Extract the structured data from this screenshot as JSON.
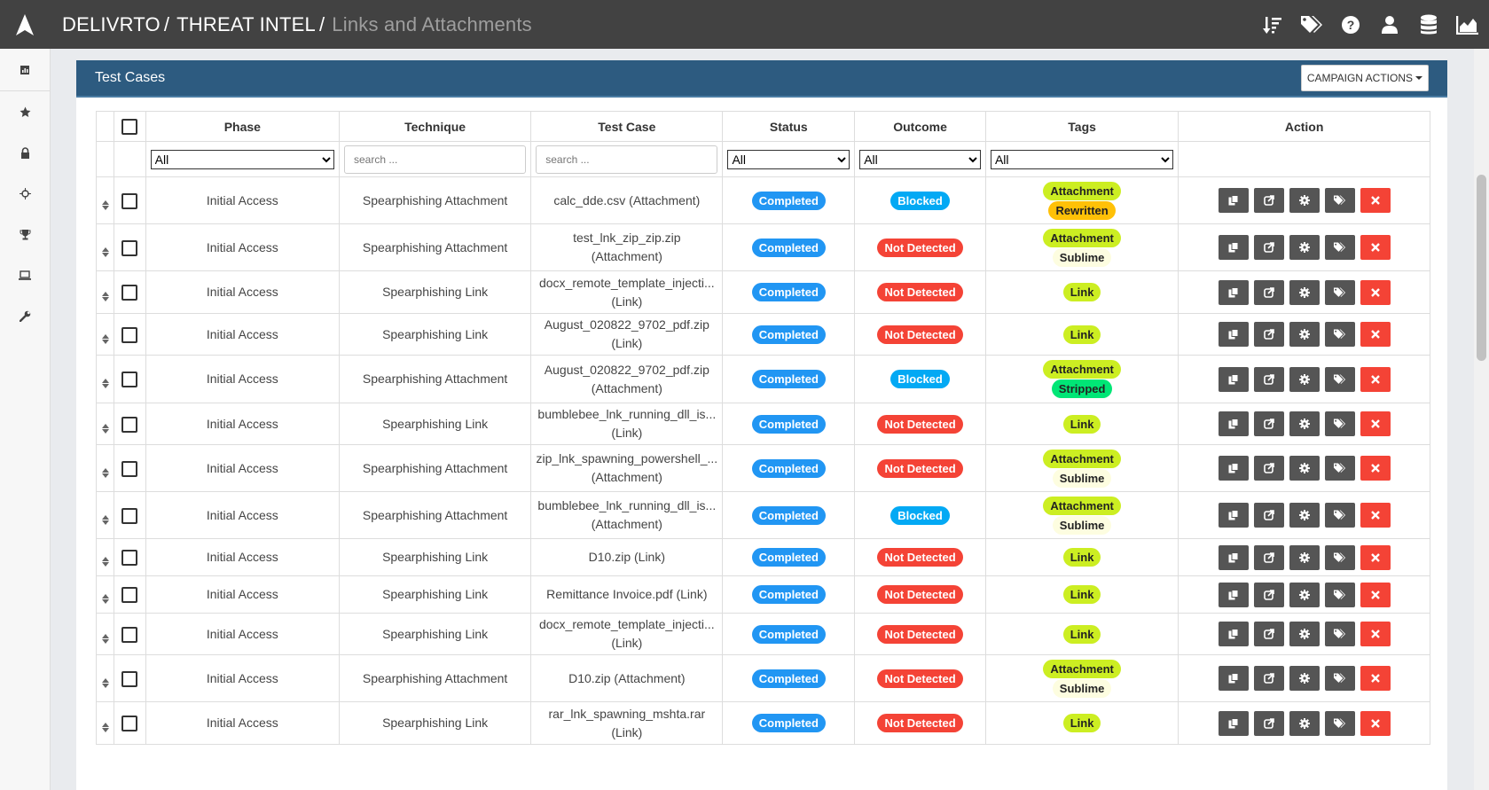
{
  "breadcrumb": {
    "items": [
      "DELIVRTO",
      "THREAT INTEL"
    ],
    "separator": "/",
    "current": "Links and Attachments"
  },
  "top_icons": [
    "sort-icon",
    "tags-icon",
    "help-icon",
    "user-icon",
    "database-icon",
    "chart-icon"
  ],
  "sidebar": {
    "items": [
      "dashboard-icon",
      "star-icon",
      "lock-icon",
      "crosshair-icon",
      "trophy-icon",
      "laptop-icon",
      "wrench-icon"
    ]
  },
  "panel": {
    "title": "Test Cases",
    "campaign_actions_label": "CAMPAIGN ACTIONS"
  },
  "table": {
    "headers": [
      "Phase",
      "Technique",
      "Test Case",
      "Status",
      "Outcome",
      "Tags",
      "Action"
    ],
    "filters": {
      "phase": "All",
      "technique_placeholder": "search ...",
      "testcase_placeholder": "search ...",
      "status": "All",
      "outcome": "All",
      "tags": "All"
    },
    "rows": [
      {
        "phase": "Initial Access",
        "technique": "Spearphishing Attachment",
        "case1": "calc_dde.csv (Attachment)",
        "case2": "",
        "status": "Completed",
        "outcome": "Blocked",
        "tags": [
          "Attachment",
          "Rewritten"
        ]
      },
      {
        "phase": "Initial Access",
        "technique": "Spearphishing Attachment",
        "case1": "test_lnk_zip_zip.zip",
        "case2": "(Attachment)",
        "status": "Completed",
        "outcome": "Not Detected",
        "tags": [
          "Attachment",
          "Sublime"
        ]
      },
      {
        "phase": "Initial Access",
        "technique": "Spearphishing Link",
        "case1": "docx_remote_template_injecti...",
        "case2": "(Link)",
        "status": "Completed",
        "outcome": "Not Detected",
        "tags": [
          "Link"
        ]
      },
      {
        "phase": "Initial Access",
        "technique": "Spearphishing Link",
        "case1": "August_020822_9702_pdf.zip",
        "case2": "(Link)",
        "status": "Completed",
        "outcome": "Not Detected",
        "tags": [
          "Link"
        ]
      },
      {
        "phase": "Initial Access",
        "technique": "Spearphishing Attachment",
        "case1": "August_020822_9702_pdf.zip",
        "case2": "(Attachment)",
        "status": "Completed",
        "outcome": "Blocked",
        "tags": [
          "Attachment",
          "Stripped"
        ]
      },
      {
        "phase": "Initial Access",
        "technique": "Spearphishing Link",
        "case1": "bumblebee_lnk_running_dll_is...",
        "case2": "(Link)",
        "status": "Completed",
        "outcome": "Not Detected",
        "tags": [
          "Link"
        ]
      },
      {
        "phase": "Initial Access",
        "technique": "Spearphishing Attachment",
        "case1": "zip_lnk_spawning_powershell_...",
        "case2": "(Attachment)",
        "status": "Completed",
        "outcome": "Not Detected",
        "tags": [
          "Attachment",
          "Sublime"
        ]
      },
      {
        "phase": "Initial Access",
        "technique": "Spearphishing Attachment",
        "case1": "bumblebee_lnk_running_dll_is...",
        "case2": "(Attachment)",
        "status": "Completed",
        "outcome": "Blocked",
        "tags": [
          "Attachment",
          "Sublime"
        ]
      },
      {
        "phase": "Initial Access",
        "technique": "Spearphishing Link",
        "case1": "D10.zip (Link)",
        "case2": "",
        "status": "Completed",
        "outcome": "Not Detected",
        "tags": [
          "Link"
        ]
      },
      {
        "phase": "Initial Access",
        "technique": "Spearphishing Link",
        "case1": "Remittance Invoice.pdf (Link)",
        "case2": "",
        "status": "Completed",
        "outcome": "Not Detected",
        "tags": [
          "Link"
        ]
      },
      {
        "phase": "Initial Access",
        "technique": "Spearphishing Link",
        "case1": "docx_remote_template_injecti...",
        "case2": "(Link)",
        "status": "Completed",
        "outcome": "Not Detected",
        "tags": [
          "Link"
        ]
      },
      {
        "phase": "Initial Access",
        "technique": "Spearphishing Attachment",
        "case1": "D10.zip (Attachment)",
        "case2": "",
        "status": "Completed",
        "outcome": "Not Detected",
        "tags": [
          "Attachment",
          "Sublime"
        ]
      },
      {
        "phase": "Initial Access",
        "technique": "Spearphishing Link",
        "case1": "rar_lnk_spawning_mshta.rar",
        "case2": "(Link)",
        "status": "Completed",
        "outcome": "Not Detected",
        "tags": [
          "Link"
        ]
      }
    ]
  },
  "colors": {
    "topbar": "#424242",
    "panel_header": "#2d5b80",
    "completed": "#2196f3",
    "blocked": "#03a9f4",
    "not_detected": "#f44336",
    "tag_lime": "#ccee22",
    "tag_rewritten": "#ffc107",
    "tag_stripped": "#00e676",
    "tag_sublime": "#fdfde0",
    "delete_button": "#f44336"
  }
}
